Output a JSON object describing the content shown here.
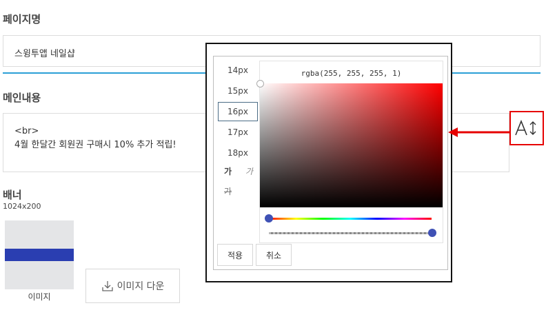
{
  "page_name": {
    "label": "페이지명",
    "value": "스윙투앱 네일샵"
  },
  "main_content": {
    "label": "메인내용",
    "line1": "<br>",
    "line2": "4월 한달간 회원권 구매시 10% 추가 적립!"
  },
  "banner": {
    "label": "배너",
    "size": "1024x200",
    "image_caption": "이미지",
    "download_label": "이미지 다운"
  },
  "font_popup": {
    "sizes": [
      "14px",
      "15px",
      "16px",
      "17px",
      "18px"
    ],
    "selected_size": "16px",
    "bold_sample": "가",
    "italic_sample": "가",
    "strike_sample": "가",
    "color_value": "rgba(255, 255, 255, 1)",
    "hue_level": 0,
    "alpha_level": 1,
    "apply_label": "적용",
    "cancel_label": "취소"
  },
  "colors": {
    "accent_blue": "#2a9fd6",
    "highlight_red": "#e60000",
    "knob": "#3f51b5"
  },
  "icons": {
    "font_size": "font-size-icon",
    "download": "download-icon",
    "arrow": "arrow-left-icon"
  }
}
